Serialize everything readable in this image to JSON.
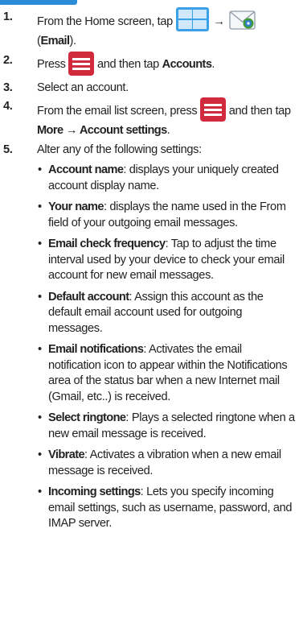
{
  "steps": [
    {
      "num": "1.",
      "a": "From the Home screen, tap ",
      "arrow": "→",
      "b": " (",
      "bold": "Email",
      "c": ")."
    },
    {
      "num": "2.",
      "a": "Press ",
      "b": " and then tap ",
      "bold": "Accounts",
      "c": "."
    },
    {
      "num": "3.",
      "text": "Select an account."
    },
    {
      "num": "4.",
      "a": "From the email list screen, press ",
      "b": " and then tap ",
      "bold": "More → Account settings",
      "c": "."
    },
    {
      "num": "5.",
      "text": "Alter any of the following settings:"
    }
  ],
  "settings": [
    {
      "name": "Account name",
      "desc": ": displays your uniquely created account display name."
    },
    {
      "name": "Your name",
      "desc": ": displays the name used in the From field of your outgoing email messages."
    },
    {
      "name": "Email check frequency",
      "desc": ": Tap to adjust the time interval used by your device to check your email account for new email messages."
    },
    {
      "name": "Default account",
      "desc": ": Assign this account as the default email account used for outgoing messages."
    },
    {
      "name": "Email notifications",
      "desc": ": Activates the email notification icon to appear within the Notifications area of the status bar when a new Internet mail (Gmail, etc..) is received."
    },
    {
      "name": "Select ringtone",
      "desc": ": Plays a selected ringtone when a new email message is received."
    },
    {
      "name": "Vibrate",
      "desc": ": Activates a vibration when a new email message is received."
    },
    {
      "name": "Incoming settings",
      "desc": ": Lets you specify incoming email settings, such as username, password, and IMAP server."
    }
  ],
  "icons": {
    "apps": "apps-grid-icon",
    "email": "email-envelope-icon",
    "menu": "menu-key-icon"
  },
  "colors": {
    "accent_blue": "#3aa0e8",
    "menu_red": "#d12a3c",
    "text": "#222222"
  }
}
